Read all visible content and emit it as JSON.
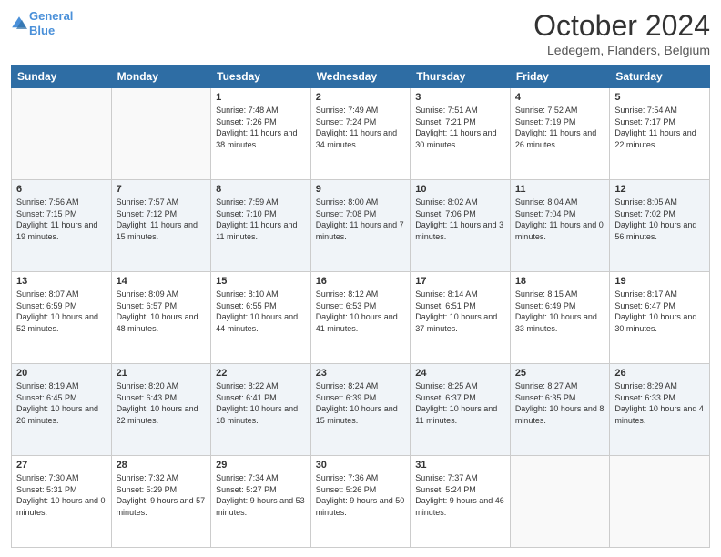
{
  "header": {
    "logo_line1": "General",
    "logo_line2": "Blue",
    "month": "October 2024",
    "location": "Ledegem, Flanders, Belgium"
  },
  "weekdays": [
    "Sunday",
    "Monday",
    "Tuesday",
    "Wednesday",
    "Thursday",
    "Friday",
    "Saturday"
  ],
  "weeks": [
    [
      {
        "day": "",
        "sunrise": "",
        "sunset": "",
        "daylight": ""
      },
      {
        "day": "",
        "sunrise": "",
        "sunset": "",
        "daylight": ""
      },
      {
        "day": "1",
        "sunrise": "Sunrise: 7:48 AM",
        "sunset": "Sunset: 7:26 PM",
        "daylight": "Daylight: 11 hours and 38 minutes."
      },
      {
        "day": "2",
        "sunrise": "Sunrise: 7:49 AM",
        "sunset": "Sunset: 7:24 PM",
        "daylight": "Daylight: 11 hours and 34 minutes."
      },
      {
        "day": "3",
        "sunrise": "Sunrise: 7:51 AM",
        "sunset": "Sunset: 7:21 PM",
        "daylight": "Daylight: 11 hours and 30 minutes."
      },
      {
        "day": "4",
        "sunrise": "Sunrise: 7:52 AM",
        "sunset": "Sunset: 7:19 PM",
        "daylight": "Daylight: 11 hours and 26 minutes."
      },
      {
        "day": "5",
        "sunrise": "Sunrise: 7:54 AM",
        "sunset": "Sunset: 7:17 PM",
        "daylight": "Daylight: 11 hours and 22 minutes."
      }
    ],
    [
      {
        "day": "6",
        "sunrise": "Sunrise: 7:56 AM",
        "sunset": "Sunset: 7:15 PM",
        "daylight": "Daylight: 11 hours and 19 minutes."
      },
      {
        "day": "7",
        "sunrise": "Sunrise: 7:57 AM",
        "sunset": "Sunset: 7:12 PM",
        "daylight": "Daylight: 11 hours and 15 minutes."
      },
      {
        "day": "8",
        "sunrise": "Sunrise: 7:59 AM",
        "sunset": "Sunset: 7:10 PM",
        "daylight": "Daylight: 11 hours and 11 minutes."
      },
      {
        "day": "9",
        "sunrise": "Sunrise: 8:00 AM",
        "sunset": "Sunset: 7:08 PM",
        "daylight": "Daylight: 11 hours and 7 minutes."
      },
      {
        "day": "10",
        "sunrise": "Sunrise: 8:02 AM",
        "sunset": "Sunset: 7:06 PM",
        "daylight": "Daylight: 11 hours and 3 minutes."
      },
      {
        "day": "11",
        "sunrise": "Sunrise: 8:04 AM",
        "sunset": "Sunset: 7:04 PM",
        "daylight": "Daylight: 11 hours and 0 minutes."
      },
      {
        "day": "12",
        "sunrise": "Sunrise: 8:05 AM",
        "sunset": "Sunset: 7:02 PM",
        "daylight": "Daylight: 10 hours and 56 minutes."
      }
    ],
    [
      {
        "day": "13",
        "sunrise": "Sunrise: 8:07 AM",
        "sunset": "Sunset: 6:59 PM",
        "daylight": "Daylight: 10 hours and 52 minutes."
      },
      {
        "day": "14",
        "sunrise": "Sunrise: 8:09 AM",
        "sunset": "Sunset: 6:57 PM",
        "daylight": "Daylight: 10 hours and 48 minutes."
      },
      {
        "day": "15",
        "sunrise": "Sunrise: 8:10 AM",
        "sunset": "Sunset: 6:55 PM",
        "daylight": "Daylight: 10 hours and 44 minutes."
      },
      {
        "day": "16",
        "sunrise": "Sunrise: 8:12 AM",
        "sunset": "Sunset: 6:53 PM",
        "daylight": "Daylight: 10 hours and 41 minutes."
      },
      {
        "day": "17",
        "sunrise": "Sunrise: 8:14 AM",
        "sunset": "Sunset: 6:51 PM",
        "daylight": "Daylight: 10 hours and 37 minutes."
      },
      {
        "day": "18",
        "sunrise": "Sunrise: 8:15 AM",
        "sunset": "Sunset: 6:49 PM",
        "daylight": "Daylight: 10 hours and 33 minutes."
      },
      {
        "day": "19",
        "sunrise": "Sunrise: 8:17 AM",
        "sunset": "Sunset: 6:47 PM",
        "daylight": "Daylight: 10 hours and 30 minutes."
      }
    ],
    [
      {
        "day": "20",
        "sunrise": "Sunrise: 8:19 AM",
        "sunset": "Sunset: 6:45 PM",
        "daylight": "Daylight: 10 hours and 26 minutes."
      },
      {
        "day": "21",
        "sunrise": "Sunrise: 8:20 AM",
        "sunset": "Sunset: 6:43 PM",
        "daylight": "Daylight: 10 hours and 22 minutes."
      },
      {
        "day": "22",
        "sunrise": "Sunrise: 8:22 AM",
        "sunset": "Sunset: 6:41 PM",
        "daylight": "Daylight: 10 hours and 18 minutes."
      },
      {
        "day": "23",
        "sunrise": "Sunrise: 8:24 AM",
        "sunset": "Sunset: 6:39 PM",
        "daylight": "Daylight: 10 hours and 15 minutes."
      },
      {
        "day": "24",
        "sunrise": "Sunrise: 8:25 AM",
        "sunset": "Sunset: 6:37 PM",
        "daylight": "Daylight: 10 hours and 11 minutes."
      },
      {
        "day": "25",
        "sunrise": "Sunrise: 8:27 AM",
        "sunset": "Sunset: 6:35 PM",
        "daylight": "Daylight: 10 hours and 8 minutes."
      },
      {
        "day": "26",
        "sunrise": "Sunrise: 8:29 AM",
        "sunset": "Sunset: 6:33 PM",
        "daylight": "Daylight: 10 hours and 4 minutes."
      }
    ],
    [
      {
        "day": "27",
        "sunrise": "Sunrise: 7:30 AM",
        "sunset": "Sunset: 5:31 PM",
        "daylight": "Daylight: 10 hours and 0 minutes."
      },
      {
        "day": "28",
        "sunrise": "Sunrise: 7:32 AM",
        "sunset": "Sunset: 5:29 PM",
        "daylight": "Daylight: 9 hours and 57 minutes."
      },
      {
        "day": "29",
        "sunrise": "Sunrise: 7:34 AM",
        "sunset": "Sunset: 5:27 PM",
        "daylight": "Daylight: 9 hours and 53 minutes."
      },
      {
        "day": "30",
        "sunrise": "Sunrise: 7:36 AM",
        "sunset": "Sunset: 5:26 PM",
        "daylight": "Daylight: 9 hours and 50 minutes."
      },
      {
        "day": "31",
        "sunrise": "Sunrise: 7:37 AM",
        "sunset": "Sunset: 5:24 PM",
        "daylight": "Daylight: 9 hours and 46 minutes."
      },
      {
        "day": "",
        "sunrise": "",
        "sunset": "",
        "daylight": ""
      },
      {
        "day": "",
        "sunrise": "",
        "sunset": "",
        "daylight": ""
      }
    ]
  ]
}
